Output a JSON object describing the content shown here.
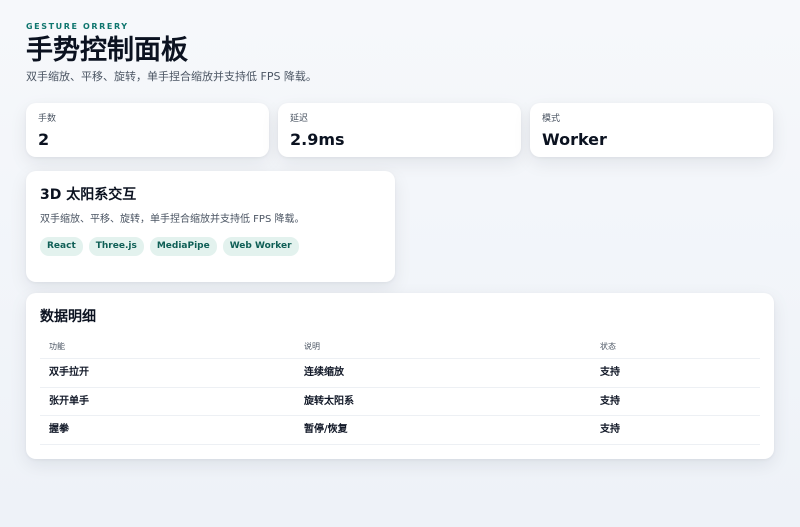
{
  "header": {
    "eyebrow": "GESTURE ORRERY",
    "title": "手势控制面板",
    "subtitle": "双手缩放、平移、旋转，单手捏合缩放并支持低 FPS 降载。"
  },
  "stats": [
    {
      "label": "手数",
      "value": "2"
    },
    {
      "label": "延迟",
      "value": "2.9ms"
    },
    {
      "label": "模式",
      "value": "Worker"
    }
  ],
  "project": {
    "title": "3D 太阳系交互",
    "description": "双手缩放、平移、旋转，单手捏合缩放并支持低 FPS 降载。",
    "tags": [
      "React",
      "Three.js",
      "MediaPipe",
      "Web Worker"
    ]
  },
  "data_table": {
    "title": "数据明细",
    "columns": [
      "功能",
      "说明",
      "状态"
    ],
    "rows": [
      [
        "双手拉开",
        "连续缩放",
        "支持"
      ],
      [
        "张开单手",
        "旋转太阳系",
        "支持"
      ],
      [
        "握拳",
        "暂停/恢复",
        "支持"
      ]
    ]
  }
}
